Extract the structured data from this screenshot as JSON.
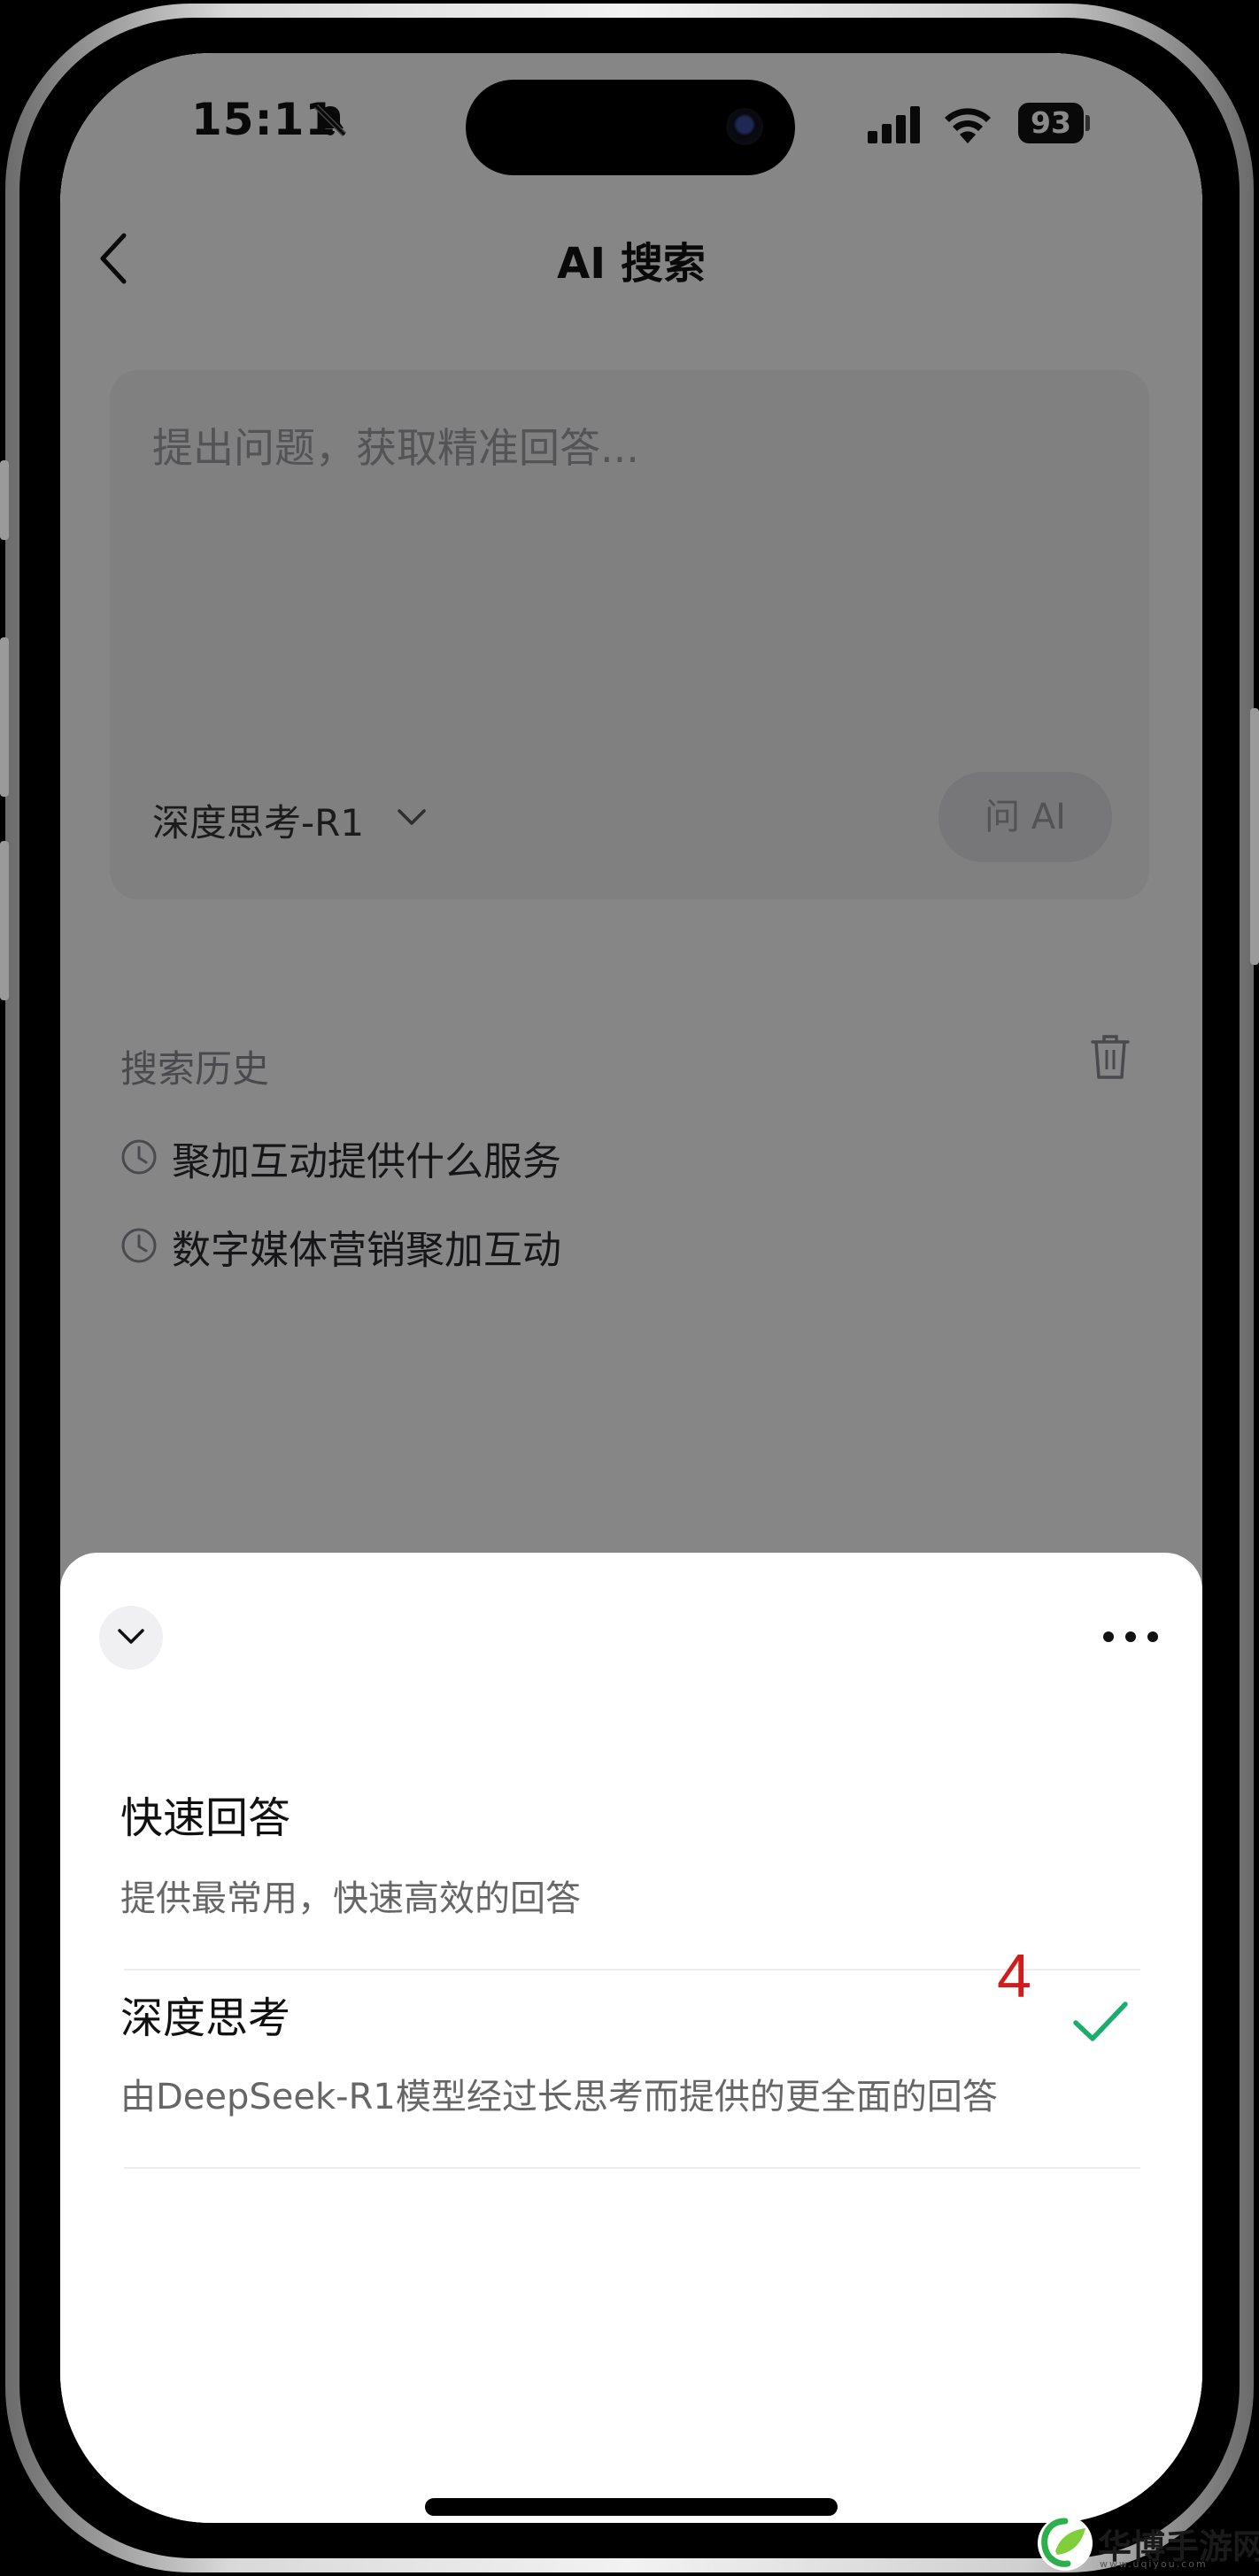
{
  "status_bar": {
    "time": "15:11",
    "battery": "93"
  },
  "nav": {
    "title": "AI 搜索"
  },
  "query": {
    "placeholder": "提出问题，获取精准回答...",
    "model_label": "深度思考-R1",
    "ask_label": "问 AI"
  },
  "history": {
    "label": "搜索历史",
    "items": [
      {
        "text": "聚加互动提供什么服务"
      },
      {
        "text": "数字媒体营销聚加互动"
      }
    ]
  },
  "sheet": {
    "options": [
      {
        "title": "快速回答",
        "desc": "提供最常用，快速高效的回答",
        "selected": false
      },
      {
        "title": "深度思考",
        "desc": "由DeepSeek-R1模型经过长思考而提供的更全面的回答",
        "selected": true
      }
    ],
    "annotation": "4"
  },
  "watermark": {
    "text": "华博手游网",
    "sub": "www.uqiyou.com"
  },
  "colors": {
    "check": "#1aad6b",
    "annotation": "#d01c1c"
  },
  "icons": [
    "bell-slash-icon",
    "signal-icon",
    "wifi-icon",
    "back-chevron-icon",
    "chevron-down-icon",
    "trash-icon",
    "clock-icon",
    "more-icon",
    "check-icon"
  ]
}
